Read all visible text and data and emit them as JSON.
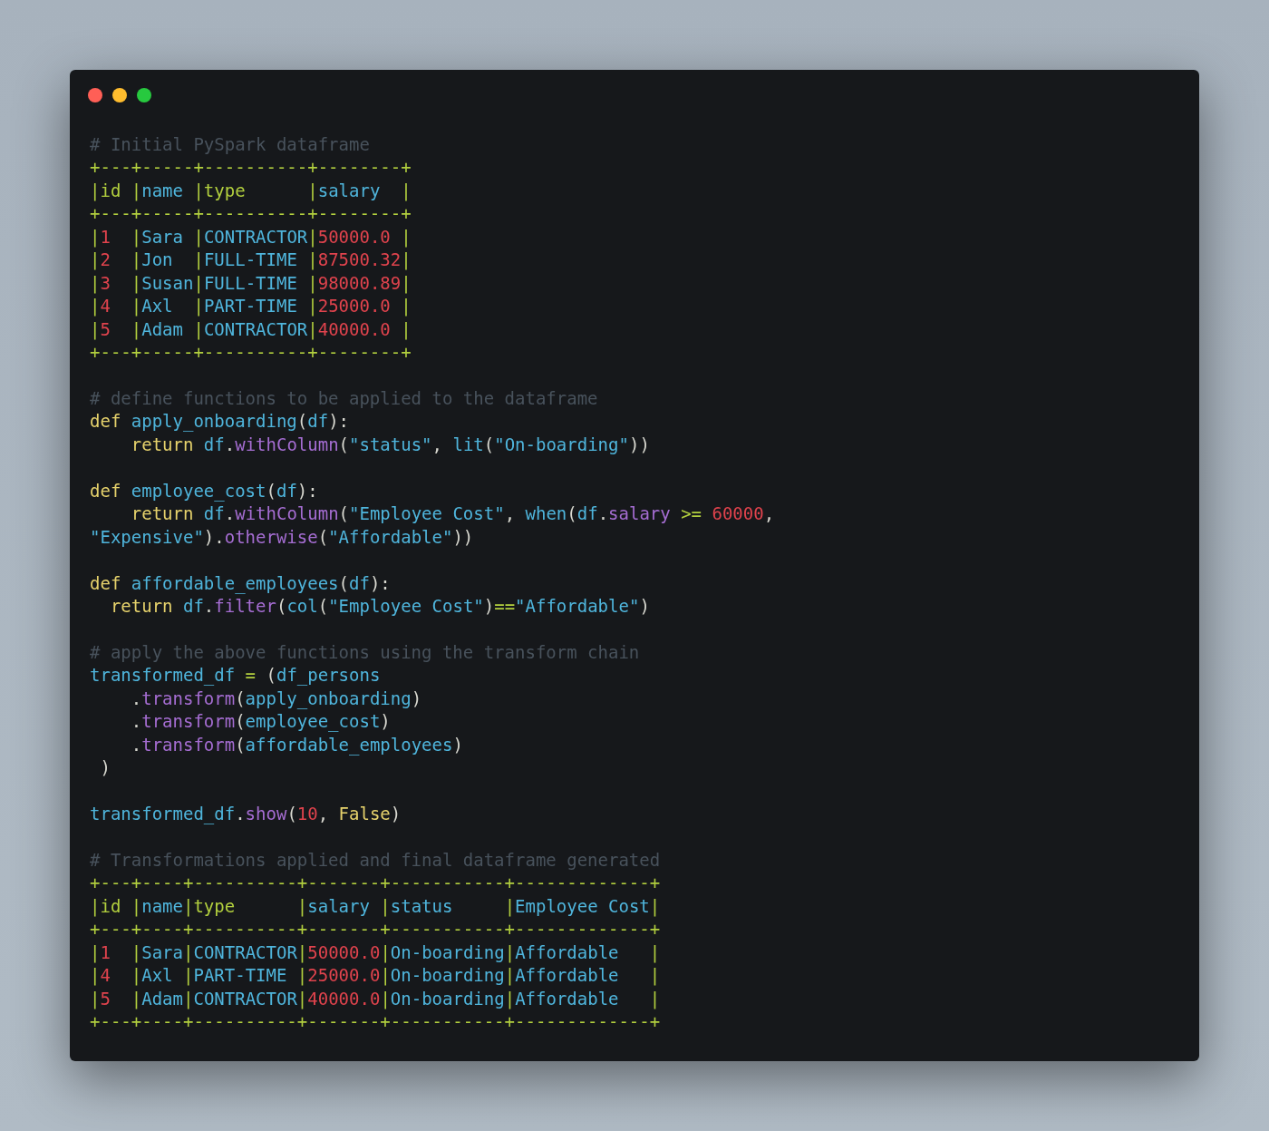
{
  "window": {
    "blocks": [
      {
        "lines": [
          {
            "tokens": [
              {
                "kind": "comment",
                "text": "# Initial PySpark dataframe"
              }
            ]
          },
          {
            "tokens": [
              {
                "kind": "border",
                "text": "+---+-----+----------+--------+"
              }
            ]
          },
          {
            "tokens": [
              {
                "kind": "border",
                "text": "|id |"
              },
              {
                "kind": "name",
                "text": "name "
              },
              {
                "kind": "border",
                "text": "|type      |"
              },
              {
                "kind": "name",
                "text": "salary  "
              },
              {
                "kind": "border",
                "text": "|"
              }
            ]
          },
          {
            "tokens": [
              {
                "kind": "border",
                "text": "+---+-----+----------+--------+"
              }
            ]
          },
          {
            "tokens": [
              {
                "kind": "border",
                "text": "|"
              },
              {
                "kind": "number",
                "text": "1  "
              },
              {
                "kind": "border",
                "text": "|"
              },
              {
                "kind": "name",
                "text": "Sara "
              },
              {
                "kind": "border",
                "text": "|"
              },
              {
                "kind": "name",
                "text": "CONTRACTOR"
              },
              {
                "kind": "border",
                "text": "|"
              },
              {
                "kind": "number",
                "text": "50000.0 "
              },
              {
                "kind": "border",
                "text": "|"
              }
            ]
          },
          {
            "tokens": [
              {
                "kind": "border",
                "text": "|"
              },
              {
                "kind": "number",
                "text": "2  "
              },
              {
                "kind": "border",
                "text": "|"
              },
              {
                "kind": "name",
                "text": "Jon  "
              },
              {
                "kind": "border",
                "text": "|"
              },
              {
                "kind": "name",
                "text": "FULL-TIME "
              },
              {
                "kind": "border",
                "text": "|"
              },
              {
                "kind": "number",
                "text": "87500.32"
              },
              {
                "kind": "border",
                "text": "|"
              }
            ]
          },
          {
            "tokens": [
              {
                "kind": "border",
                "text": "|"
              },
              {
                "kind": "number",
                "text": "3  "
              },
              {
                "kind": "border",
                "text": "|"
              },
              {
                "kind": "name",
                "text": "Susan"
              },
              {
                "kind": "border",
                "text": "|"
              },
              {
                "kind": "name",
                "text": "FULL-TIME "
              },
              {
                "kind": "border",
                "text": "|"
              },
              {
                "kind": "number",
                "text": "98000.89"
              },
              {
                "kind": "border",
                "text": "|"
              }
            ]
          },
          {
            "tokens": [
              {
                "kind": "border",
                "text": "|"
              },
              {
                "kind": "number",
                "text": "4  "
              },
              {
                "kind": "border",
                "text": "|"
              },
              {
                "kind": "name",
                "text": "Axl  "
              },
              {
                "kind": "border",
                "text": "|"
              },
              {
                "kind": "name",
                "text": "PART-TIME "
              },
              {
                "kind": "border",
                "text": "|"
              },
              {
                "kind": "number",
                "text": "25000.0 "
              },
              {
                "kind": "border",
                "text": "|"
              }
            ]
          },
          {
            "tokens": [
              {
                "kind": "border",
                "text": "|"
              },
              {
                "kind": "number",
                "text": "5  "
              },
              {
                "kind": "border",
                "text": "|"
              },
              {
                "kind": "name",
                "text": "Adam "
              },
              {
                "kind": "border",
                "text": "|"
              },
              {
                "kind": "name",
                "text": "CONTRACTOR"
              },
              {
                "kind": "border",
                "text": "|"
              },
              {
                "kind": "number",
                "text": "40000.0 "
              },
              {
                "kind": "border",
                "text": "|"
              }
            ]
          },
          {
            "tokens": [
              {
                "kind": "border",
                "text": "+---+-----+----------+--------+"
              }
            ]
          }
        ]
      },
      {
        "lines": [
          {
            "tokens": [
              {
                "kind": "comment",
                "text": "# define functions to be applied to the dataframe"
              }
            ]
          },
          {
            "tokens": [
              {
                "kind": "keyword",
                "text": "def "
              },
              {
                "kind": "name",
                "text": "apply_onboarding"
              },
              {
                "kind": "punct",
                "text": "("
              },
              {
                "kind": "name",
                "text": "df"
              },
              {
                "kind": "punct",
                "text": "):"
              }
            ]
          },
          {
            "tokens": [
              {
                "kind": "keyword",
                "text": "    return "
              },
              {
                "kind": "name",
                "text": "df"
              },
              {
                "kind": "punct",
                "text": "."
              },
              {
                "kind": "method",
                "text": "withColumn"
              },
              {
                "kind": "punct",
                "text": "("
              },
              {
                "kind": "name",
                "text": "\"status\""
              },
              {
                "kind": "punct",
                "text": ", "
              },
              {
                "kind": "name",
                "text": "lit"
              },
              {
                "kind": "punct",
                "text": "("
              },
              {
                "kind": "name",
                "text": "\"On-boarding\""
              },
              {
                "kind": "punct",
                "text": "))"
              }
            ]
          }
        ]
      },
      {
        "lines": [
          {
            "tokens": [
              {
                "kind": "keyword",
                "text": "def "
              },
              {
                "kind": "name",
                "text": "employee_cost"
              },
              {
                "kind": "punct",
                "text": "("
              },
              {
                "kind": "name",
                "text": "df"
              },
              {
                "kind": "punct",
                "text": "):"
              }
            ]
          },
          {
            "tokens": [
              {
                "kind": "keyword",
                "text": "    return "
              },
              {
                "kind": "name",
                "text": "df"
              },
              {
                "kind": "punct",
                "text": "."
              },
              {
                "kind": "method",
                "text": "withColumn"
              },
              {
                "kind": "punct",
                "text": "("
              },
              {
                "kind": "name",
                "text": "\"Employee Cost\""
              },
              {
                "kind": "punct",
                "text": ", "
              },
              {
                "kind": "name",
                "text": "when"
              },
              {
                "kind": "punct",
                "text": "("
              },
              {
                "kind": "name",
                "text": "df"
              },
              {
                "kind": "punct",
                "text": "."
              },
              {
                "kind": "method",
                "text": "salary"
              },
              {
                "kind": "operator",
                "text": " >= "
              },
              {
                "kind": "number",
                "text": "60000"
              },
              {
                "kind": "punct",
                "text": ","
              }
            ]
          },
          {
            "tokens": [
              {
                "kind": "name",
                "text": "\"Expensive\""
              },
              {
                "kind": "punct",
                "text": ")."
              },
              {
                "kind": "method",
                "text": "otherwise"
              },
              {
                "kind": "punct",
                "text": "("
              },
              {
                "kind": "name",
                "text": "\"Affordable\""
              },
              {
                "kind": "punct",
                "text": "))"
              }
            ]
          }
        ]
      },
      {
        "lines": [
          {
            "tokens": [
              {
                "kind": "keyword",
                "text": "def "
              },
              {
                "kind": "name",
                "text": "affordable_employees"
              },
              {
                "kind": "punct",
                "text": "("
              },
              {
                "kind": "name",
                "text": "df"
              },
              {
                "kind": "punct",
                "text": "):"
              }
            ]
          },
          {
            "tokens": [
              {
                "kind": "keyword",
                "text": "  return "
              },
              {
                "kind": "name",
                "text": "df"
              },
              {
                "kind": "punct",
                "text": "."
              },
              {
                "kind": "method",
                "text": "filter"
              },
              {
                "kind": "punct",
                "text": "("
              },
              {
                "kind": "name",
                "text": "col"
              },
              {
                "kind": "punct",
                "text": "("
              },
              {
                "kind": "name",
                "text": "\"Employee Cost\""
              },
              {
                "kind": "punct",
                "text": ")"
              },
              {
                "kind": "operator",
                "text": "=="
              },
              {
                "kind": "name",
                "text": "\"Affordable\""
              },
              {
                "kind": "punct",
                "text": ")"
              }
            ]
          }
        ]
      },
      {
        "lines": [
          {
            "tokens": [
              {
                "kind": "comment",
                "text": "# apply the above functions using the transform chain"
              }
            ]
          },
          {
            "tokens": [
              {
                "kind": "name",
                "text": "transformed_df"
              },
              {
                "kind": "operator",
                "text": " = "
              },
              {
                "kind": "punct",
                "text": "("
              },
              {
                "kind": "name",
                "text": "df_persons"
              }
            ]
          },
          {
            "tokens": [
              {
                "kind": "punct",
                "text": "    ."
              },
              {
                "kind": "method",
                "text": "transform"
              },
              {
                "kind": "punct",
                "text": "("
              },
              {
                "kind": "name",
                "text": "apply_onboarding"
              },
              {
                "kind": "punct",
                "text": ")"
              }
            ]
          },
          {
            "tokens": [
              {
                "kind": "punct",
                "text": "    ."
              },
              {
                "kind": "method",
                "text": "transform"
              },
              {
                "kind": "punct",
                "text": "("
              },
              {
                "kind": "name",
                "text": "employee_cost"
              },
              {
                "kind": "punct",
                "text": ")"
              }
            ]
          },
          {
            "tokens": [
              {
                "kind": "punct",
                "text": "    ."
              },
              {
                "kind": "method",
                "text": "transform"
              },
              {
                "kind": "punct",
                "text": "("
              },
              {
                "kind": "name",
                "text": "affordable_employees"
              },
              {
                "kind": "punct",
                "text": ")"
              }
            ]
          },
          {
            "tokens": [
              {
                "kind": "punct",
                "text": " )"
              }
            ]
          }
        ]
      },
      {
        "lines": [
          {
            "tokens": [
              {
                "kind": "name",
                "text": "transformed_df"
              },
              {
                "kind": "punct",
                "text": "."
              },
              {
                "kind": "method",
                "text": "show"
              },
              {
                "kind": "punct",
                "text": "("
              },
              {
                "kind": "number",
                "text": "10"
              },
              {
                "kind": "punct",
                "text": ", "
              },
              {
                "kind": "keyword",
                "text": "False"
              },
              {
                "kind": "punct",
                "text": ")"
              }
            ]
          }
        ]
      },
      {
        "lines": [
          {
            "tokens": [
              {
                "kind": "comment",
                "text": "# Transformations applied and final dataframe generated"
              }
            ]
          },
          {
            "tokens": [
              {
                "kind": "border",
                "text": "+---+----+----------+-------+-----------+-------------+"
              }
            ]
          },
          {
            "tokens": [
              {
                "kind": "border",
                "text": "|id |"
              },
              {
                "kind": "name",
                "text": "name"
              },
              {
                "kind": "border",
                "text": "|type      |"
              },
              {
                "kind": "name",
                "text": "salary "
              },
              {
                "kind": "border",
                "text": "|"
              },
              {
                "kind": "name",
                "text": "status     "
              },
              {
                "kind": "border",
                "text": "|"
              },
              {
                "kind": "name",
                "text": "Employee Cost"
              },
              {
                "kind": "border",
                "text": "|"
              }
            ]
          },
          {
            "tokens": [
              {
                "kind": "border",
                "text": "+---+----+----------+-------+-----------+-------------+"
              }
            ]
          },
          {
            "tokens": [
              {
                "kind": "border",
                "text": "|"
              },
              {
                "kind": "number",
                "text": "1  "
              },
              {
                "kind": "border",
                "text": "|"
              },
              {
                "kind": "name",
                "text": "Sara"
              },
              {
                "kind": "border",
                "text": "|"
              },
              {
                "kind": "name",
                "text": "CONTRACTOR"
              },
              {
                "kind": "border",
                "text": "|"
              },
              {
                "kind": "number",
                "text": "50000.0"
              },
              {
                "kind": "border",
                "text": "|"
              },
              {
                "kind": "name",
                "text": "On-boarding"
              },
              {
                "kind": "border",
                "text": "|"
              },
              {
                "kind": "name",
                "text": "Affordable   "
              },
              {
                "kind": "border",
                "text": "|"
              }
            ]
          },
          {
            "tokens": [
              {
                "kind": "border",
                "text": "|"
              },
              {
                "kind": "number",
                "text": "4  "
              },
              {
                "kind": "border",
                "text": "|"
              },
              {
                "kind": "name",
                "text": "Axl "
              },
              {
                "kind": "border",
                "text": "|"
              },
              {
                "kind": "name",
                "text": "PART-TIME "
              },
              {
                "kind": "border",
                "text": "|"
              },
              {
                "kind": "number",
                "text": "25000.0"
              },
              {
                "kind": "border",
                "text": "|"
              },
              {
                "kind": "name",
                "text": "On-boarding"
              },
              {
                "kind": "border",
                "text": "|"
              },
              {
                "kind": "name",
                "text": "Affordable   "
              },
              {
                "kind": "border",
                "text": "|"
              }
            ]
          },
          {
            "tokens": [
              {
                "kind": "border",
                "text": "|"
              },
              {
                "kind": "number",
                "text": "5  "
              },
              {
                "kind": "border",
                "text": "|"
              },
              {
                "kind": "name",
                "text": "Adam"
              },
              {
                "kind": "border",
                "text": "|"
              },
              {
                "kind": "name",
                "text": "CONTRACTOR"
              },
              {
                "kind": "border",
                "text": "|"
              },
              {
                "kind": "number",
                "text": "40000.0"
              },
              {
                "kind": "border",
                "text": "|"
              },
              {
                "kind": "name",
                "text": "On-boarding"
              },
              {
                "kind": "border",
                "text": "|"
              },
              {
                "kind": "name",
                "text": "Affordable   "
              },
              {
                "kind": "border",
                "text": "|"
              }
            ]
          },
          {
            "tokens": [
              {
                "kind": "border",
                "text": "+---+----+----------+-------+-----------+-------------+"
              }
            ]
          }
        ]
      }
    ]
  }
}
